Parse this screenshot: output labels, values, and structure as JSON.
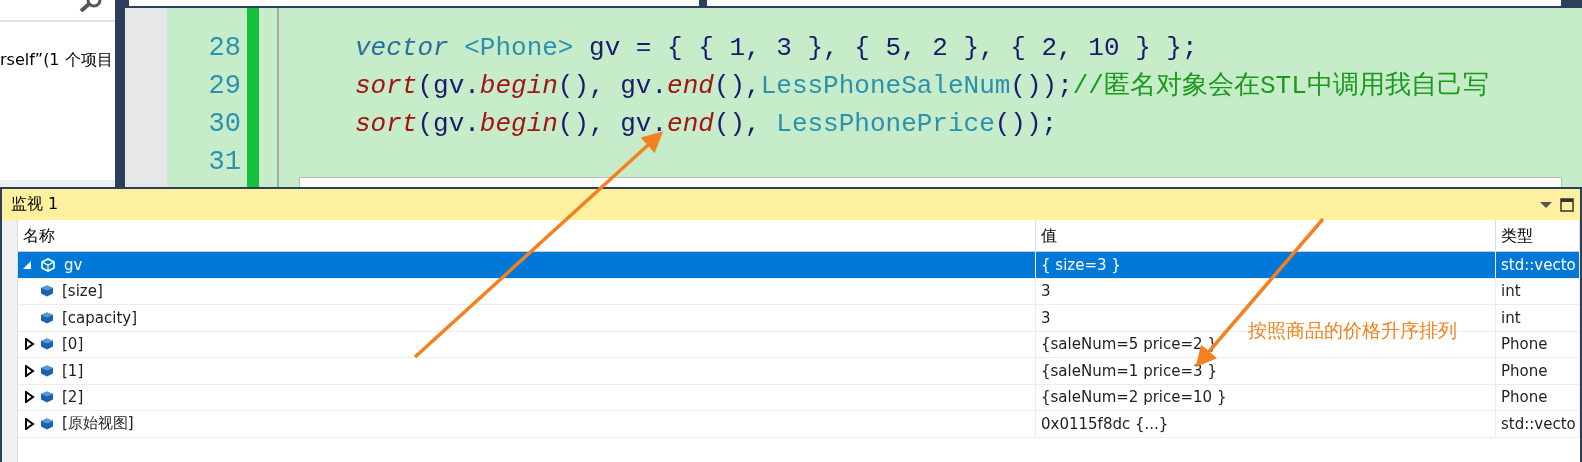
{
  "solution_pane": {
    "text": "rself”(1 个项目"
  },
  "editor": {
    "lines": [
      {
        "number": "28",
        "tokens": [
          {
            "kind": "type",
            "text": "vector "
          },
          {
            "kind": "class",
            "text": "<Phone>"
          },
          {
            "kind": "plain",
            "text": " gv = { { 1, 3 }, { 5, 2 }, { 2, 10 } };"
          }
        ]
      },
      {
        "number": "29",
        "tokens": [
          {
            "kind": "func",
            "text": "sort"
          },
          {
            "kind": "plain",
            "text": "(gv."
          },
          {
            "kind": "func",
            "text": "begin"
          },
          {
            "kind": "plain",
            "text": "(), gv."
          },
          {
            "kind": "func",
            "text": "end"
          },
          {
            "kind": "plain",
            "text": "(),"
          },
          {
            "kind": "class",
            "text": "LessPhoneSaleNum"
          },
          {
            "kind": "plain",
            "text": "());"
          },
          {
            "kind": "comment",
            "text": "//匿名对象会在STL中调用我自己写"
          }
        ]
      },
      {
        "number": "30",
        "tokens": [
          {
            "kind": "func",
            "text": "sort"
          },
          {
            "kind": "plain",
            "text": "(gv."
          },
          {
            "kind": "func",
            "text": "begin"
          },
          {
            "kind": "plain",
            "text": "(), gv."
          },
          {
            "kind": "func",
            "text": "end"
          },
          {
            "kind": "plain",
            "text": "(), "
          },
          {
            "kind": "class",
            "text": "LessPhonePrice"
          },
          {
            "kind": "plain",
            "text": "());"
          }
        ]
      },
      {
        "number": "31"
      }
    ]
  },
  "watch": {
    "title": "监视 1",
    "columns": [
      "名称",
      "值",
      "类型"
    ],
    "rows": [
      {
        "kind": "node",
        "name": "gv",
        "value": "{ size=3 }",
        "type": "std::vecto",
        "selected": true,
        "expanded": true,
        "children": [
          {
            "kind": "leaf",
            "name": "[size]",
            "value": "3",
            "type": "int",
            "selected": false
          },
          {
            "kind": "leaf",
            "name": "[capacity]",
            "value": "3",
            "type": "int",
            "selected": false
          },
          {
            "kind": "node",
            "name": "[0]",
            "value": "{saleNum=5 price=2 }",
            "type": "Phone",
            "selected": false,
            "expanded": false
          },
          {
            "kind": "node",
            "name": "[1]",
            "value": "{saleNum=1 price=3 }",
            "type": "Phone",
            "selected": false,
            "expanded": false
          },
          {
            "kind": "node",
            "name": "[2]",
            "value": "{saleNum=2 price=10 }",
            "type": "Phone",
            "selected": false,
            "expanded": false
          },
          {
            "kind": "node",
            "name": "[原始视图]",
            "value": "0x0115f8dc {...}",
            "type": "std::vecto",
            "selected": false,
            "expanded": false
          }
        ]
      }
    ]
  },
  "annotation": {
    "text": "按照商品的价格升序排列"
  }
}
